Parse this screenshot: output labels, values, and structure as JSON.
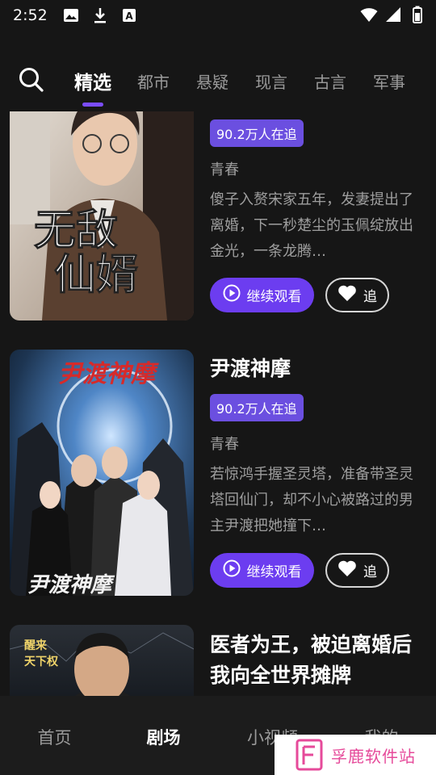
{
  "status_bar": {
    "time": "2:52",
    "left_icons": [
      "image-icon",
      "download-icon",
      "a-box-icon"
    ],
    "right_icons": [
      "wifi-icon",
      "signal-icon",
      "battery-icon"
    ]
  },
  "top_nav": {
    "search_icon": "search-icon",
    "tabs": [
      {
        "label": "精选",
        "active": true
      },
      {
        "label": "都市",
        "active": false
      },
      {
        "label": "悬疑",
        "active": false
      },
      {
        "label": "现言",
        "active": false
      },
      {
        "label": "古言",
        "active": false
      },
      {
        "label": "军事",
        "active": false
      }
    ],
    "accent_color": "#7b4dff"
  },
  "dramas": [
    {
      "title": "",
      "badge": "90.2万人在追",
      "genre": "青春",
      "description": "傻子入赘宋家五年，发妻提出了离婚，下一秒楚尘的玉佩绽放出金光，一条龙腾…",
      "watch_label": "继续观看",
      "follow_label": "追",
      "poster_text": "无敌仙婿"
    },
    {
      "title": "尹渡神摩",
      "badge": "90.2万人在追",
      "genre": "青春",
      "description": "若惊鸿手握圣灵塔，准备带圣灵塔回仙门，却不小心被路过的男主尹渡把她撞下…",
      "watch_label": "继续观看",
      "follow_label": "追",
      "poster_text": "尹渡神摩"
    },
    {
      "title": "医者为王，被迫离婚后我向全世界摊牌",
      "badge": "",
      "genre": "",
      "description": "",
      "watch_label": "",
      "follow_label": "",
      "poster_text": "醒来天下权"
    }
  ],
  "bottom_nav": [
    {
      "label": "首页",
      "active": false
    },
    {
      "label": "剧场",
      "active": true
    },
    {
      "label": "小视频",
      "active": false
    },
    {
      "label": "我的",
      "active": false
    }
  ],
  "watermark": {
    "text": "孚鹿软件站"
  }
}
